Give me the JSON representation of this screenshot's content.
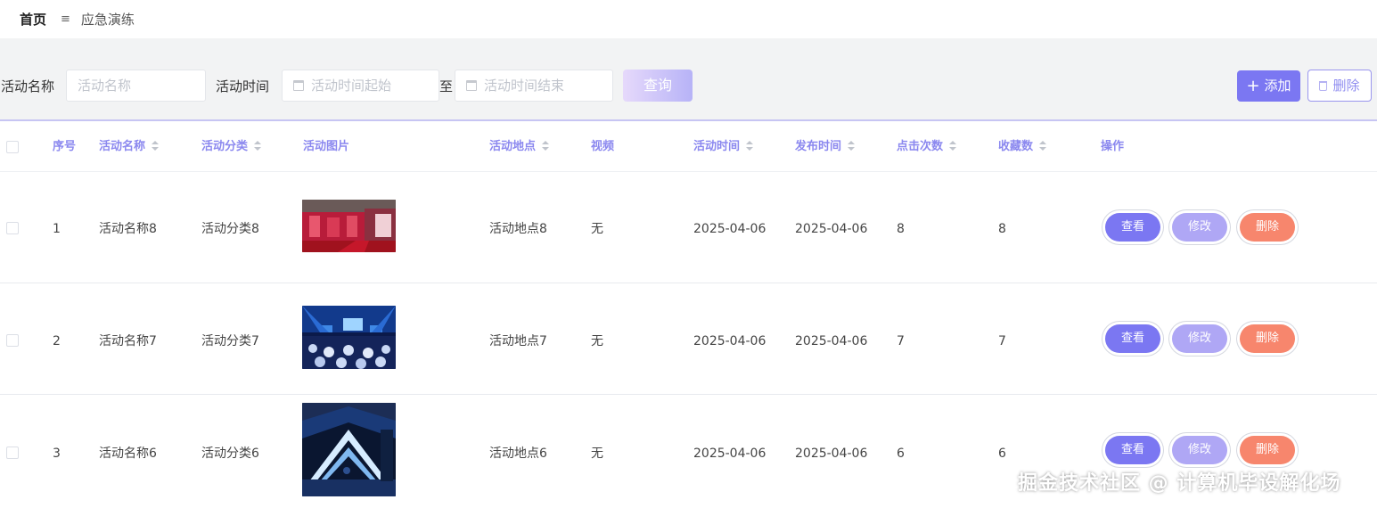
{
  "breadcrumb": {
    "home": "首页",
    "separator": "≡",
    "current": "应急演练"
  },
  "filters": {
    "name_label": "活动名称",
    "name_placeholder": "活动名称",
    "time_label": "活动时间",
    "time_start_placeholder": "活动时间起始",
    "time_to": "至",
    "time_end_placeholder": "活动时间结束",
    "query_button": "查询",
    "add_button": "添加",
    "delete_button": "删除"
  },
  "table": {
    "columns": [
      "序号",
      "活动名称",
      "活动分类",
      "活动图片",
      "活动地点",
      "视频",
      "活动时间",
      "发布时间",
      "点击次数",
      "收藏数",
      "操作"
    ],
    "rows": [
      {
        "index": "1",
        "name": "活动名称8",
        "category": "活动分类8",
        "location": "活动地点8",
        "video": "无",
        "activity_time": "2025-04-06",
        "publish_time": "2025-04-06",
        "clicks": "8",
        "favorites": "8"
      },
      {
        "index": "2",
        "name": "活动名称7",
        "category": "活动分类7",
        "location": "活动地点7",
        "video": "无",
        "activity_time": "2025-04-06",
        "publish_time": "2025-04-06",
        "clicks": "7",
        "favorites": "7"
      },
      {
        "index": "3",
        "name": "活动名称6",
        "category": "活动分类6",
        "location": "活动地点6",
        "video": "无",
        "activity_time": "2025-04-06",
        "publish_time": "2025-04-06",
        "clicks": "6",
        "favorites": "6"
      }
    ],
    "actions": {
      "view": "查看",
      "edit": "修改",
      "delete": "删除"
    }
  },
  "watermark": "掘金技术社区 @ 计算机毕设解化场",
  "colors": {
    "accent": "#7b77f2",
    "edit": "#afa7f5",
    "danger": "#f7866d",
    "header_text": "#8b88ef"
  }
}
